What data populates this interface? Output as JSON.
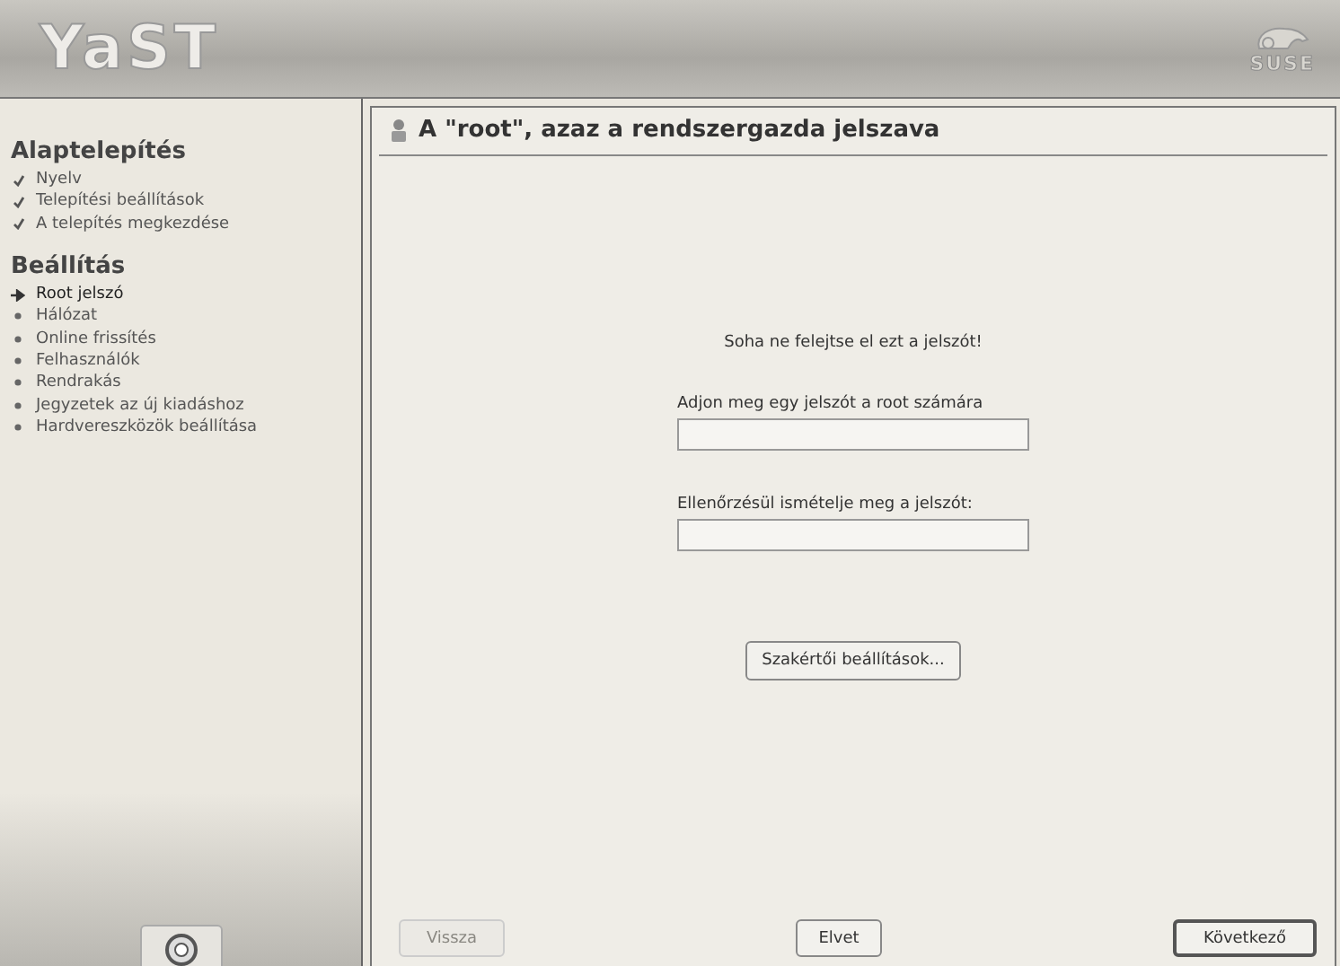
{
  "header": {
    "logo": "YaST",
    "brand": "SUSE"
  },
  "sidebar": {
    "sections": [
      {
        "title": "Alaptelepítés",
        "items": [
          {
            "label": "Nyelv",
            "kind": "done"
          },
          {
            "label": "Telepítési beállítások",
            "kind": "done"
          },
          {
            "label": "A telepítés megkezdése",
            "kind": "done"
          }
        ]
      },
      {
        "title": "Beállítás",
        "items": [
          {
            "label": "Root jelszó",
            "kind": "current"
          },
          {
            "label": "Hálózat",
            "kind": "pending"
          },
          {
            "label": "Online frissítés",
            "kind": "pending"
          },
          {
            "label": "Felhasználók",
            "kind": "pending"
          },
          {
            "label": "Rendrakás",
            "kind": "pending"
          },
          {
            "label": "Jegyzetek az új kiadáshoz",
            "kind": "pending"
          },
          {
            "label": "Hardvereszközök beállítása",
            "kind": "pending"
          }
        ]
      }
    ]
  },
  "dialog": {
    "title": "A \"root\", azaz a rendszergazda jelszava",
    "note": "Soha ne felejtse el ezt a jelszót!",
    "fields": [
      {
        "label": "Adjon meg egy jelszót a root számára"
      },
      {
        "label": "Ellenőrzésül ismételje meg a jelszót:"
      }
    ],
    "expert_button": "Szakértői beállítások..."
  },
  "buttons": [
    {
      "label": "Vissza",
      "disabled": true
    },
    {
      "label": "Elvet",
      "disabled": false
    },
    {
      "label": "Következő",
      "disabled": false
    }
  ]
}
